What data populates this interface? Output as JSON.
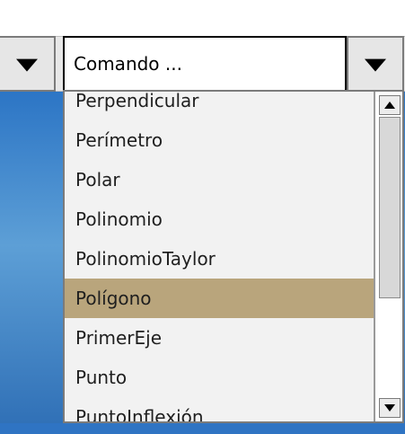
{
  "command_combo": {
    "input_text": "Comando ...",
    "list": {
      "items": [
        "Perpendicular",
        "Perímetro",
        "Polar",
        "Polinomio",
        "PolinomioTaylor",
        "Polígono",
        "PrimerEje",
        "Punto",
        "PuntoInflexión"
      ],
      "selected": "Polígono"
    }
  },
  "icons": {
    "left_dropdown": "chevron-down-icon",
    "combo_dropdown": "chevron-down-icon",
    "scroll_up": "scroll-up-icon",
    "scroll_down": "scroll-down-icon"
  },
  "colors": {
    "selection": "#b9a57c",
    "desktop_blue": "#2c75c5"
  }
}
